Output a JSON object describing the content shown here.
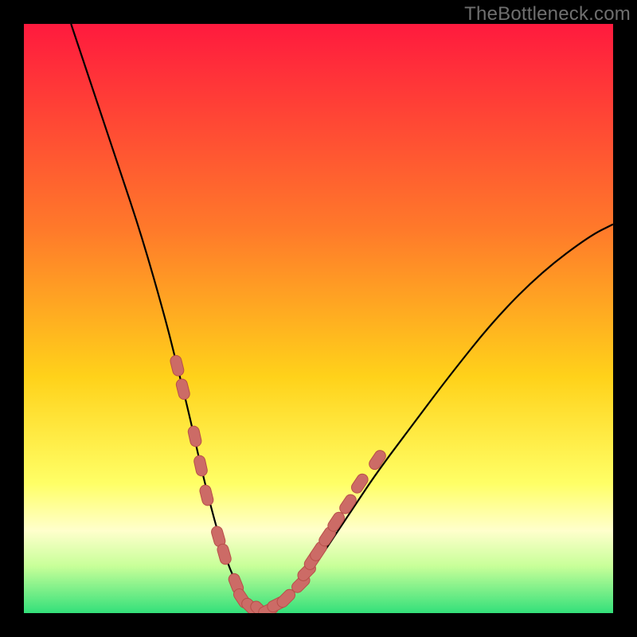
{
  "watermark": {
    "text": "TheBottleneck.com"
  },
  "colors": {
    "bg_black": "#000000",
    "grad_top": "#ff1a3e",
    "grad_mid1": "#ff7a2a",
    "grad_mid2": "#ffd21a",
    "grad_mid3": "#ffff66",
    "grad_bottom_band": "#ffffcc",
    "grad_green1": "#c8ff99",
    "grad_green2": "#33e07a",
    "curve": "#000000",
    "marker_fill": "#cc6b66",
    "marker_stroke": "#b84f49"
  },
  "chart_data": {
    "type": "line",
    "title": "",
    "xlabel": "",
    "ylabel": "",
    "xlim": [
      0,
      100
    ],
    "ylim": [
      0,
      100
    ],
    "grid": false,
    "legend": false,
    "series": [
      {
        "name": "bottleneck-curve",
        "x": [
          8,
          12,
          16,
          20,
          24,
          26,
          28,
          30,
          32,
          34,
          36,
          38,
          40,
          44,
          48,
          52,
          56,
          60,
          66,
          72,
          80,
          88,
          96,
          100
        ],
        "y": [
          100,
          88,
          76,
          64,
          50,
          42,
          34,
          25,
          17,
          10,
          5,
          2,
          0,
          2,
          6,
          12,
          18,
          24,
          32,
          40,
          50,
          58,
          64,
          66
        ]
      }
    ],
    "markers": [
      {
        "name": "left-cluster",
        "points": [
          {
            "x": 26,
            "y": 42
          },
          {
            "x": 27,
            "y": 38
          },
          {
            "x": 29,
            "y": 30
          },
          {
            "x": 30,
            "y": 25
          },
          {
            "x": 31,
            "y": 20
          },
          {
            "x": 33,
            "y": 13
          },
          {
            "x": 34,
            "y": 10
          },
          {
            "x": 36,
            "y": 5
          }
        ]
      },
      {
        "name": "valley-cluster",
        "points": [
          {
            "x": 37,
            "y": 2.5
          },
          {
            "x": 38.5,
            "y": 1
          },
          {
            "x": 40,
            "y": 0.5
          },
          {
            "x": 41.5,
            "y": 0.5
          },
          {
            "x": 43,
            "y": 1.5
          },
          {
            "x": 44.5,
            "y": 2.5
          }
        ]
      },
      {
        "name": "right-cluster",
        "points": [
          {
            "x": 47,
            "y": 5
          },
          {
            "x": 48,
            "y": 7
          },
          {
            "x": 49,
            "y": 9
          },
          {
            "x": 50,
            "y": 10.5
          },
          {
            "x": 51.5,
            "y": 13
          },
          {
            "x": 53,
            "y": 15.5
          },
          {
            "x": 55,
            "y": 18.5
          },
          {
            "x": 57,
            "y": 22
          },
          {
            "x": 60,
            "y": 26
          }
        ]
      }
    ],
    "gradient_stops": [
      {
        "offset": 0.0,
        "key": "grad_top"
      },
      {
        "offset": 0.35,
        "key": "grad_mid1"
      },
      {
        "offset": 0.6,
        "key": "grad_mid2"
      },
      {
        "offset": 0.78,
        "key": "grad_mid3"
      },
      {
        "offset": 0.86,
        "key": "grad_bottom_band"
      },
      {
        "offset": 0.92,
        "key": "grad_green1"
      },
      {
        "offset": 1.0,
        "key": "grad_green2"
      }
    ]
  }
}
